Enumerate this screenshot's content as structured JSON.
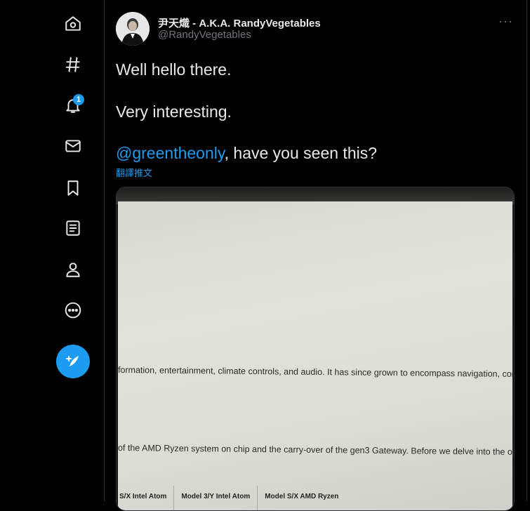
{
  "sidebar": {
    "items": [
      {
        "name": "home-icon",
        "label": "Home"
      },
      {
        "name": "explore-icon",
        "label": "Explore"
      },
      {
        "name": "notifications-icon",
        "label": "Notifications",
        "badge": "1"
      },
      {
        "name": "messages-icon",
        "label": "Messages"
      },
      {
        "name": "bookmarks-icon",
        "label": "Bookmarks"
      },
      {
        "name": "lists-icon",
        "label": "Lists"
      },
      {
        "name": "profile-icon",
        "label": "Profile"
      },
      {
        "name": "more-icon",
        "label": "More"
      }
    ],
    "compose_icon": "compose-tweet-icon"
  },
  "tweet": {
    "display_name": "尹天熾 - A.K.A. RandyVegetables",
    "handle": "@RandyVegetables",
    "line1": "Well hello there.",
    "line2": "Very interesting.",
    "mention": "@greentheonly",
    "line3_rest": ", have you seen this?",
    "translate": "翻譯推文",
    "more_label": "···"
  },
  "media": {
    "line1": "formation, entertainment, climate controls, and audio. It has since grown to encompass navigation, conn",
    "line2": "of the AMD Ryzen system on chip and the carry-over of the gen3 Gateway. Before we delve into the operat",
    "table_headers": [
      "S/X Intel Atom",
      "Model 3/Y Intel Atom",
      "Model S/X AMD Ryzen"
    ]
  },
  "colors": {
    "accent": "#1d9bf0",
    "background": "#000000",
    "text": "#e7e9ea",
    "muted": "#71767b"
  }
}
